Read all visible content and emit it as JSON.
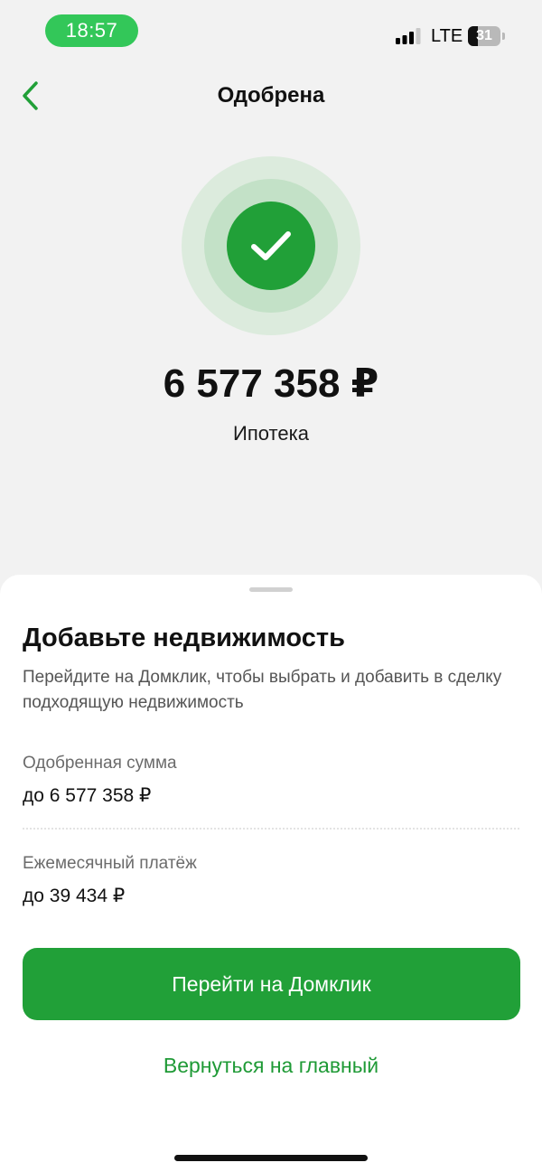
{
  "status_bar": {
    "time": "18:57",
    "network": "LTE",
    "battery_level": "31",
    "battery_fraction": 0.31,
    "signal_bars_active": 3,
    "signal_bars_total": 4
  },
  "header": {
    "title": "Одобрена",
    "back_icon": "chevron-left-icon"
  },
  "summary": {
    "status_icon": "checkmark-icon",
    "amount": "6 577 358 ₽",
    "product": "Ипотека"
  },
  "sheet": {
    "title": "Добавьте недвижимость",
    "description": "Перейдите на Домклик, чтобы выбрать и добавить в сделку подходящую недвижимость",
    "approved_label": "Одобренная сумма",
    "approved_value": "до 6 577 358 ₽",
    "payment_label": "Ежемесячный платёж",
    "payment_value": "до 39 434 ₽",
    "primary_button": "Перейти на Домклик",
    "secondary_link": "Вернуться на главный"
  },
  "colors": {
    "brand_green": "#21a038",
    "status_green": "#33c759",
    "background": "#f2f2f2"
  }
}
